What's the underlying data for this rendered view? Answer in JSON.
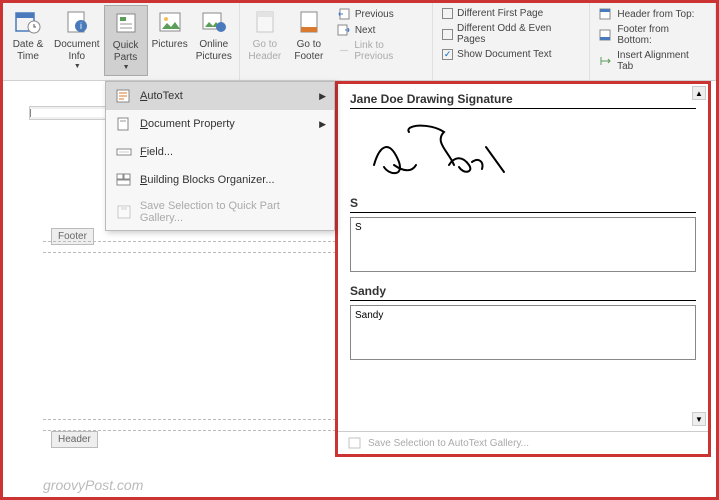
{
  "ribbon": {
    "date_time": "Date &\nTime",
    "document_info": "Document\nInfo",
    "quick_parts": "Quick\nParts",
    "pictures": "Pictures",
    "online_pictures": "Online\nPictures",
    "goto_header": "Go to\nHeader",
    "goto_footer": "Go to\nFooter",
    "nav": {
      "previous": "Previous",
      "next": "Next",
      "link": "Link to Previous"
    },
    "opts": {
      "first": "Different First Page",
      "odd_even": "Different Odd & Even Pages",
      "show_doc": "Show Document Text"
    },
    "pos": {
      "from_top": "Header from Top:",
      "from_bottom": "Footer from Bottom:",
      "align": "Insert Alignment Tab"
    }
  },
  "menu": {
    "autotext": "AutoText",
    "docprop": "Document Property",
    "field": "Field...",
    "bbo": "Building Blocks Organizer...",
    "save_qp": "Save Selection to Quick Part Gallery..."
  },
  "gallery": {
    "h1": "Jane Doe Drawing Signature",
    "h2": "S",
    "p2": "S",
    "h3": "Sandy",
    "p3": "Sandy",
    "footer": "Save Selection to AutoText Gallery..."
  },
  "doc": {
    "footer_label": "Footer",
    "header_label": "Header"
  },
  "watermark": "groovyPost.com"
}
